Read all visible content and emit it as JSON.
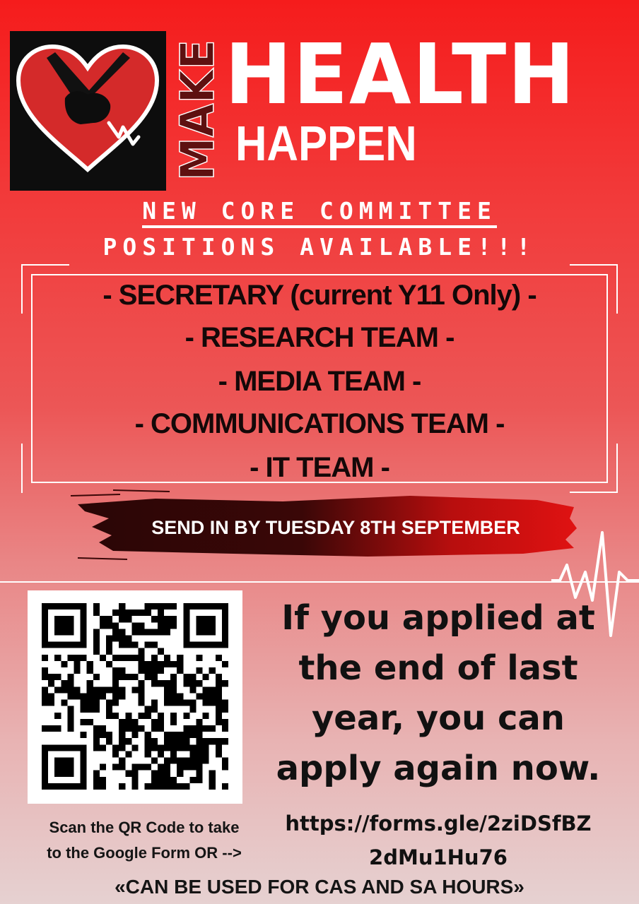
{
  "logo": {
    "make": "MAKE",
    "health": "HEALTH",
    "happen": "HAPPEN",
    "icon": "heart-hands-icon"
  },
  "headline": {
    "line1": "NEW CORE COMMITTEE",
    "line2": "POSITIONS AVAILABLE!!!"
  },
  "positions": [
    "- SECRETARY (current Y11 Only) -",
    "- RESEARCH TEAM -",
    "- MEDIA TEAM -",
    "- COMMUNICATIONS TEAM -",
    "- IT TEAM -"
  ],
  "deadline": "SEND IN BY TUESDAY 8TH SEPTEMBER",
  "reapply": [
    "If you applied at",
    "the end of last",
    "year, you can",
    "apply again now."
  ],
  "qr": {
    "icon": "qr-code-icon"
  },
  "scan": [
    "Scan the QR Code to take",
    "to the Google Form OR -->"
  ],
  "form_url": [
    "https://forms.gle/2ziDSfBZ",
    "2dMu1Hu76"
  ],
  "footer": "«CAN BE USED FOR CAS AND SA HOURS»",
  "colors": {
    "top": "#f51c1c",
    "bottom": "#e6d1d1",
    "dark_red": "#8a1a1a",
    "brush_red": "#d41010"
  }
}
